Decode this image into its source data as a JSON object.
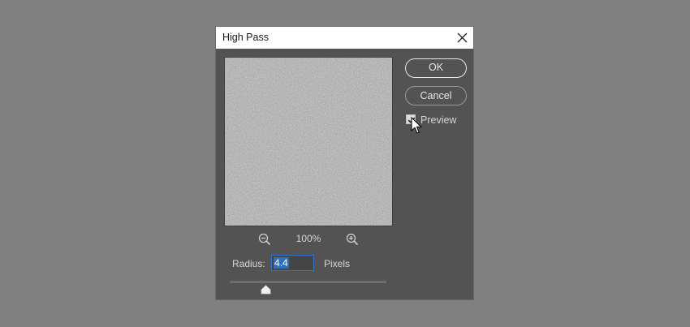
{
  "dialog": {
    "title": "High Pass",
    "close_icon": "close-icon"
  },
  "preview": {
    "zoom_level": "100%",
    "zoom_out_icon": "zoom-out-icon",
    "zoom_in_icon": "zoom-in-icon"
  },
  "radius": {
    "label": "Radius:",
    "value": "4.4",
    "unit": "Pixels",
    "slider_fraction": 0.23
  },
  "buttons": {
    "ok_label": "OK",
    "cancel_label": "Cancel"
  },
  "options": {
    "preview_label": "Preview",
    "preview_checked": true
  },
  "colors": {
    "dialog_bg": "#535353",
    "highlight": "#2f6fc0"
  }
}
